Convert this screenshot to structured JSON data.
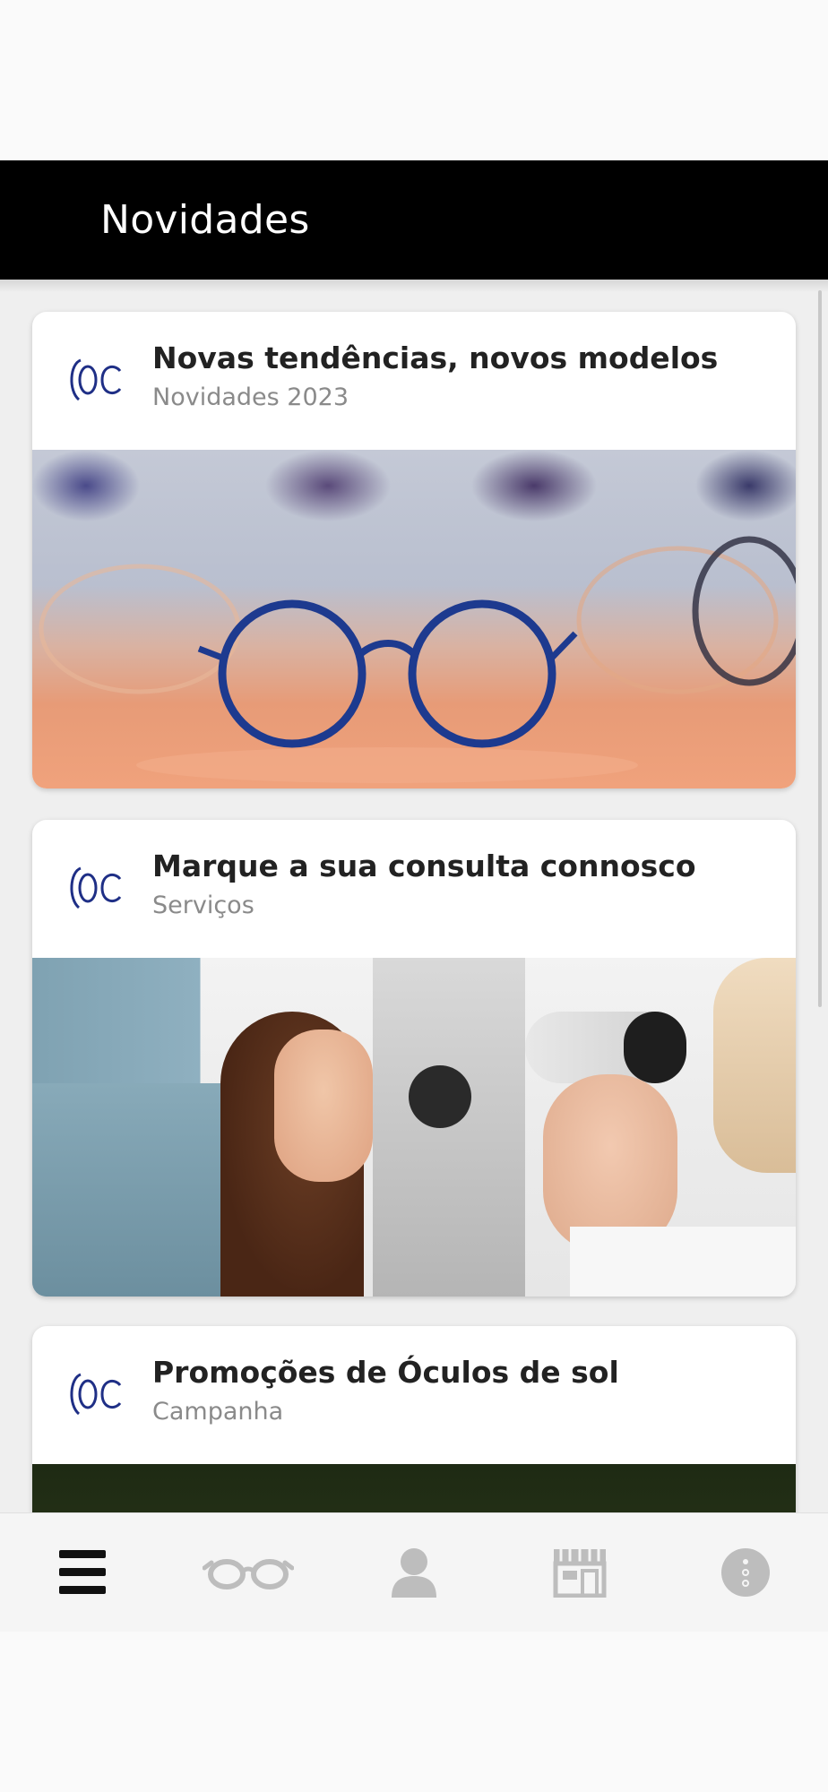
{
  "app_bar": {
    "title": "Novidades"
  },
  "cards": [
    {
      "title": "Novas tendências, novos modelos",
      "subtitle": "Novidades 2023",
      "logo": "oc-logo",
      "image": "blue-round-glasses-photo"
    },
    {
      "title": "Marque a sua consulta connosco",
      "subtitle": "Serviços",
      "logo": "oc-logo",
      "image": "eye-exam-photo"
    },
    {
      "title": "Promoções de Óculos de sol",
      "subtitle": "Campanha",
      "logo": "oc-logo",
      "image": "sunglasses-photo"
    }
  ],
  "bottom_nav": {
    "items": [
      {
        "icon": "menu-icon",
        "active": true
      },
      {
        "icon": "glasses-icon",
        "active": false
      },
      {
        "icon": "user-icon",
        "active": false
      },
      {
        "icon": "store-icon",
        "active": false
      },
      {
        "icon": "info-icon",
        "active": false
      }
    ]
  },
  "colors": {
    "app_bar": "#000000",
    "logo": "#1f2f86",
    "nav_active": "#111111",
    "nav_inactive": "#bdbdbd"
  }
}
